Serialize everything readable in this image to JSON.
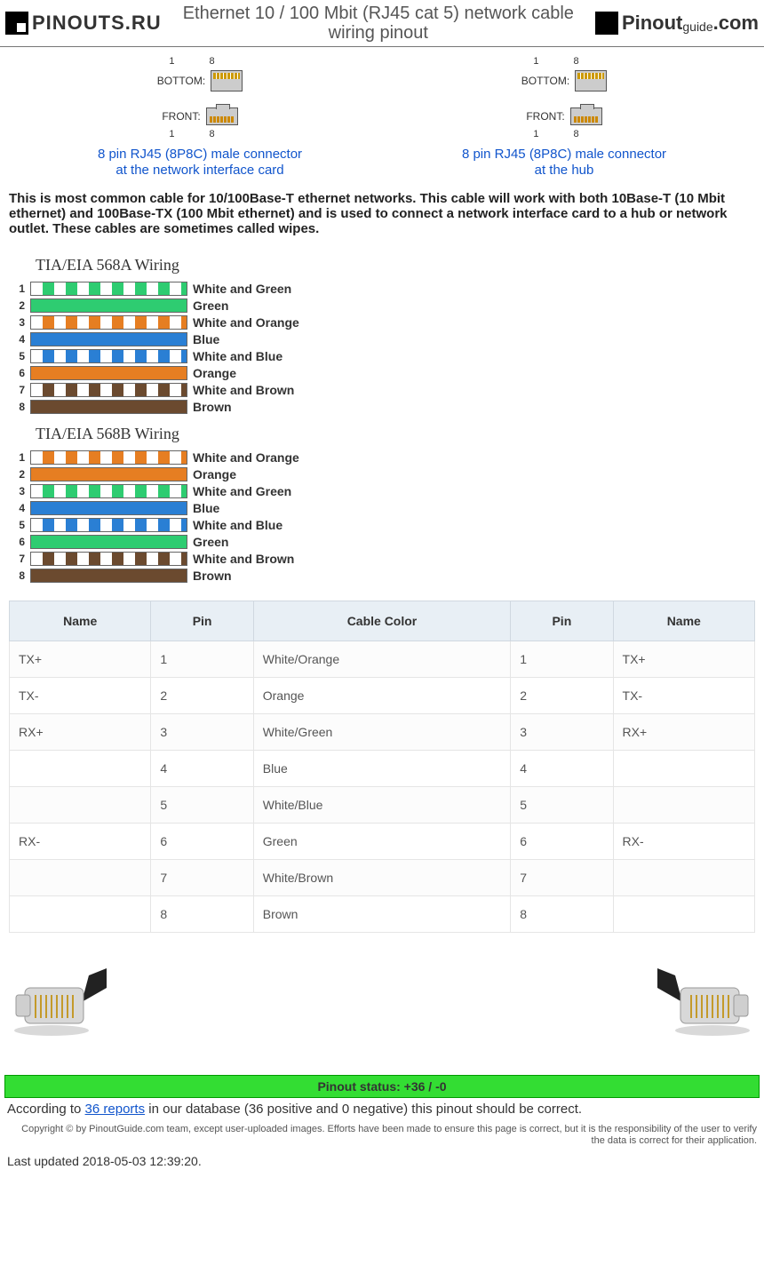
{
  "header": {
    "logo_left": "PINOUTS.RU",
    "title": "Ethernet 10 / 100 Mbit (RJ45 cat 5) network cable wiring pinout",
    "logo_right_a": "Pinout",
    "logo_right_b": "guide",
    "logo_right_c": ".com"
  },
  "connectors": {
    "bottom_label": "BOTTOM:",
    "front_label": "FRONT:",
    "nums": "1 8",
    "left_link_l1": "8 pin RJ45 (8P8C) male connector",
    "left_link_l2": "at the network interface card",
    "right_link_l1": "8 pin RJ45 (8P8C) male connector",
    "right_link_l2": "at the hub"
  },
  "intro": "This is most common cable for 10/100Base-T ethernet networks. This cable will work with both 10Base-T (10 Mbit ethernet) and 100Base-TX (100 Mbit ethernet) and is used to connect a network interface card to a hub or network outlet. These cables are sometimes called wipes.",
  "wiring": {
    "a_title": "TIA/EIA 568A Wiring",
    "b_title": "TIA/EIA 568B Wiring",
    "a": [
      {
        "n": "1",
        "label": "White and Green",
        "color": "#2ecc71",
        "striped": true
      },
      {
        "n": "2",
        "label": "Green",
        "color": "#2ecc71",
        "striped": false
      },
      {
        "n": "3",
        "label": "White and Orange",
        "color": "#e67e22",
        "striped": true
      },
      {
        "n": "4",
        "label": "Blue",
        "color": "#2a7fd4",
        "striped": false
      },
      {
        "n": "5",
        "label": "White and Blue",
        "color": "#2a7fd4",
        "striped": true
      },
      {
        "n": "6",
        "label": "Orange",
        "color": "#e67e22",
        "striped": false
      },
      {
        "n": "7",
        "label": "White and Brown",
        "color": "#6b4a2f",
        "striped": true
      },
      {
        "n": "8",
        "label": "Brown",
        "color": "#6b4a2f",
        "striped": false
      }
    ],
    "b": [
      {
        "n": "1",
        "label": "White and Orange",
        "color": "#e67e22",
        "striped": true
      },
      {
        "n": "2",
        "label": "Orange",
        "color": "#e67e22",
        "striped": false
      },
      {
        "n": "3",
        "label": "White and Green",
        "color": "#2ecc71",
        "striped": true
      },
      {
        "n": "4",
        "label": "Blue",
        "color": "#2a7fd4",
        "striped": false
      },
      {
        "n": "5",
        "label": "White and Blue",
        "color": "#2a7fd4",
        "striped": true
      },
      {
        "n": "6",
        "label": "Green",
        "color": "#2ecc71",
        "striped": false
      },
      {
        "n": "7",
        "label": "White and Brown",
        "color": "#6b4a2f",
        "striped": true
      },
      {
        "n": "8",
        "label": "Brown",
        "color": "#6b4a2f",
        "striped": false
      }
    ]
  },
  "table": {
    "headers": [
      "Name",
      "Pin",
      "Cable Color",
      "Pin",
      "Name"
    ],
    "rows": [
      [
        "TX+",
        "1",
        "White/Orange",
        "1",
        "TX+"
      ],
      [
        "TX-",
        "2",
        "Orange",
        "2",
        "TX-"
      ],
      [
        "RX+",
        "3",
        "White/Green",
        "3",
        "RX+"
      ],
      [
        "",
        "4",
        "Blue",
        "4",
        ""
      ],
      [
        "",
        "5",
        "White/Blue",
        "5",
        ""
      ],
      [
        "RX-",
        "6",
        "Green",
        "6",
        "RX-"
      ],
      [
        "",
        "7",
        "White/Brown",
        "7",
        ""
      ],
      [
        "",
        "8",
        "Brown",
        "8",
        ""
      ]
    ]
  },
  "status": {
    "bar": "Pinout status: +36 / -0",
    "pre": "According to ",
    "link": "36 reports",
    "post": " in our database (36 positive and 0 negative) this pinout should be correct."
  },
  "copyright": "Copyright © by PinoutGuide.com team, except user-uploaded images. Efforts have been made to ensure this page is correct, but it is the responsibility of the user to verify the data is correct for their application.",
  "updated": "Last updated 2018-05-03 12:39:20."
}
